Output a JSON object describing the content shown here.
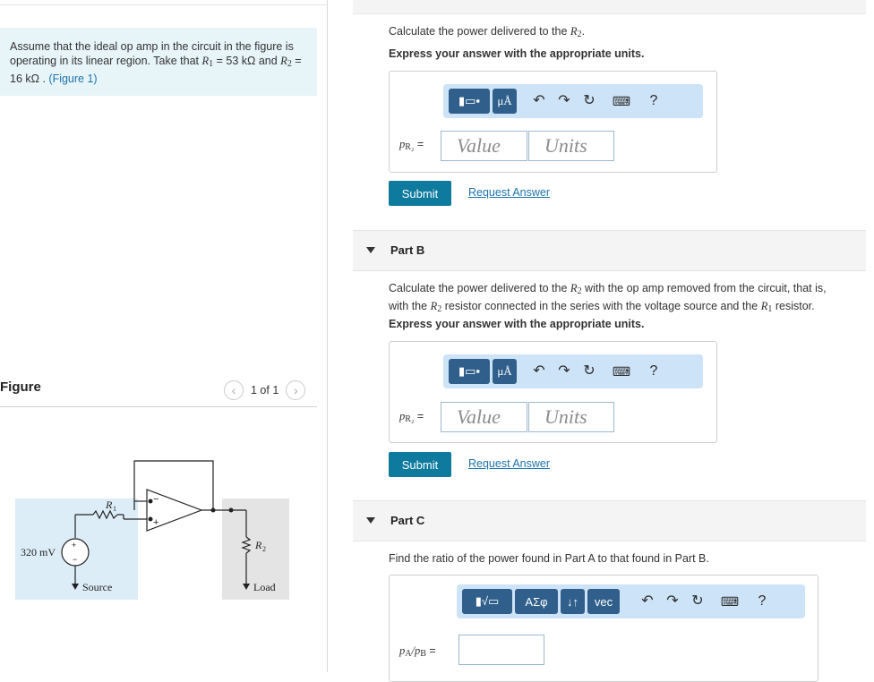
{
  "problem": {
    "text_1": "Assume that the ideal op amp in the circuit in the figure is operating in its linear region. Take that",
    "r1_symbol": "R",
    "r1_sub": "1",
    "r1_value": " = 53 kΩ and",
    "r2_symbol": "R",
    "r2_sub": "2",
    "r2_value": " = 16 kΩ .",
    "figure_link": "(Figure 1)"
  },
  "figure": {
    "title": "Figure",
    "count": "1 of 1",
    "prev_icon": "chevron-left-icon",
    "next_icon": "chevron-right-icon",
    "labels": {
      "r1": "R",
      "r1_sub": "1",
      "r2": "R",
      "r2_sub": "2",
      "voltage": "320 mV",
      "source": "Source",
      "load": "Load",
      "minus": "−",
      "plus": "+"
    }
  },
  "part_a": {
    "prompt_pre": "Calculate the power delivered to the",
    "prompt_sym": "R",
    "prompt_sub": "2",
    "prompt_post": ".",
    "express": "Express your answer with the appropriate units.",
    "answer_label": "p",
    "answer_sub": "R₂",
    "answer_eq": "=",
    "value_placeholder": "Value",
    "units_placeholder": "Units",
    "submit": "Submit",
    "request": "Request Answer"
  },
  "part_b": {
    "title": "Part B",
    "prompt_line1_pre": "Calculate the power delivered to the",
    "prompt_line1_post": "with the op amp removed from the circuit, that is,",
    "prompt_line2_pre": "with the",
    "prompt_line2_mid": "resistor connected in the series with the voltage source and the",
    "prompt_line2_post": "resistor.",
    "sym_r": "R",
    "sub_2": "2",
    "sub_1": "1",
    "express": "Express your answer with the appropriate units.",
    "answer_label": "p",
    "answer_sub": "R₂",
    "answer_eq": "=",
    "value_placeholder": "Value",
    "units_placeholder": "Units",
    "submit": "Submit",
    "request": "Request Answer"
  },
  "part_c": {
    "title": "Part C",
    "prompt": "Find the ratio of the power found in Part A to that found in Part B.",
    "answer_label": "p",
    "answer_sub_a": "A",
    "answer_slash": "/",
    "answer_label_b": "p",
    "answer_sub_b": "B",
    "answer_eq": "=",
    "toolbar": {
      "greek": "ΑΣφ",
      "arrows": "↓↑",
      "vec": "vec",
      "help": "?"
    }
  },
  "toolbar": {
    "micro": "μÅ",
    "help": "?",
    "icons": [
      "templates-icon",
      "units-icon",
      "undo-icon",
      "redo-icon",
      "reset-icon",
      "keyboard-icon",
      "help-icon"
    ]
  },
  "colors": {
    "problem_bg": "#e7f4f8",
    "toolbar_bg": "#cde3f7",
    "toolbar_btn": "#2f5f8a",
    "submit_bg": "#0d7a9e",
    "link": "#1d73ad"
  }
}
